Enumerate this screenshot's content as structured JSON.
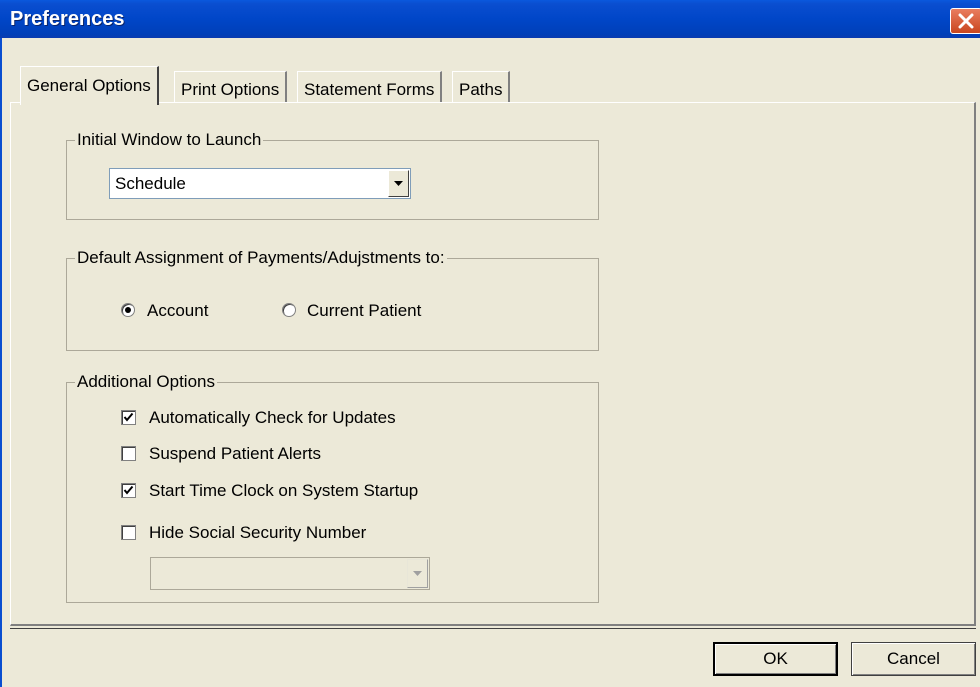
{
  "window": {
    "title": "Preferences",
    "close_icon": "close-icon"
  },
  "tabs": [
    {
      "label": "General Options",
      "active": true
    },
    {
      "label": "Print Options",
      "active": false
    },
    {
      "label": "Statement Forms",
      "active": false
    },
    {
      "label": "Paths",
      "active": false
    }
  ],
  "initial_window": {
    "group_label": "Initial Window to Launch",
    "selected": "Schedule"
  },
  "payments": {
    "group_label": "Default Assignment of Payments/Adujstments to:",
    "options": [
      {
        "label": "Account",
        "selected": true
      },
      {
        "label": "Current Patient",
        "selected": false
      }
    ]
  },
  "additional": {
    "group_label": "Additional Options",
    "options": [
      {
        "label": "Automatically Check for Updates",
        "checked": true
      },
      {
        "label": "Suspend Patient Alerts",
        "checked": false
      },
      {
        "label": "Start Time Clock on System Startup",
        "checked": true
      },
      {
        "label": "Hide Social Security Number",
        "checked": false
      }
    ],
    "ssn_select_value": ""
  },
  "buttons": {
    "ok": "OK",
    "cancel": "Cancel"
  },
  "colors": {
    "titlebar": "#0046c8",
    "dialog_bg": "#ece9d8",
    "close_button": "#c9461f"
  }
}
